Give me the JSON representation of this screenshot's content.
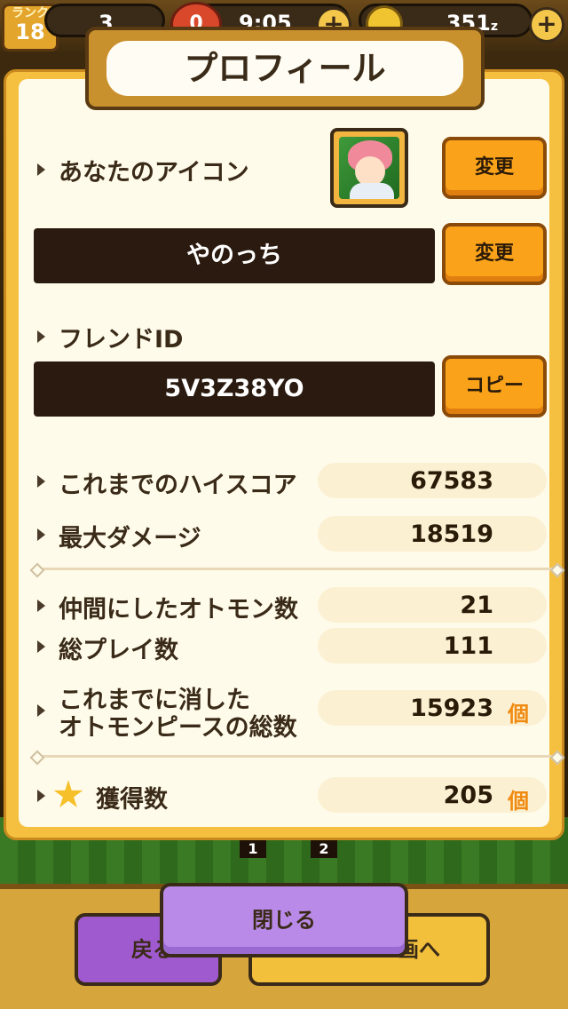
{
  "topbar": {
    "rank_label": "ランク",
    "rank_value": "18",
    "stamina_partial": "3",
    "heart_count": "0",
    "timer": "9:05",
    "coins": "351",
    "coin_unit": "z"
  },
  "panel": {
    "title": "プロフィール",
    "icon_label": "あなたのアイコン",
    "change_icon_label": "変更",
    "player_name": "やのっち",
    "change_name_label": "変更",
    "friend_id_label": "フレンドID",
    "friend_id": "5V3Z38YO",
    "copy_label": "コピー"
  },
  "stats": [
    {
      "label": "これまでのハイスコア",
      "value": "67583",
      "unit": ""
    },
    {
      "label": "最大ダメージ",
      "value": "18519",
      "unit": ""
    },
    {
      "label": "仲間にしたオトモン数",
      "value": "21",
      "unit": ""
    },
    {
      "label": "総プレイ数",
      "value": "111",
      "unit": ""
    },
    {
      "label_line1": "これまでに消した",
      "label_line2": "オトモンピースの総数",
      "value": "15923",
      "unit": "個"
    },
    {
      "label": "獲得数",
      "value": "205",
      "unit": "個"
    }
  ],
  "pagination": {
    "page1": "1",
    "page2": "2"
  },
  "buttons": {
    "close": "閉じる",
    "back_partial": "戻る",
    "next_partial": "画へ"
  }
}
